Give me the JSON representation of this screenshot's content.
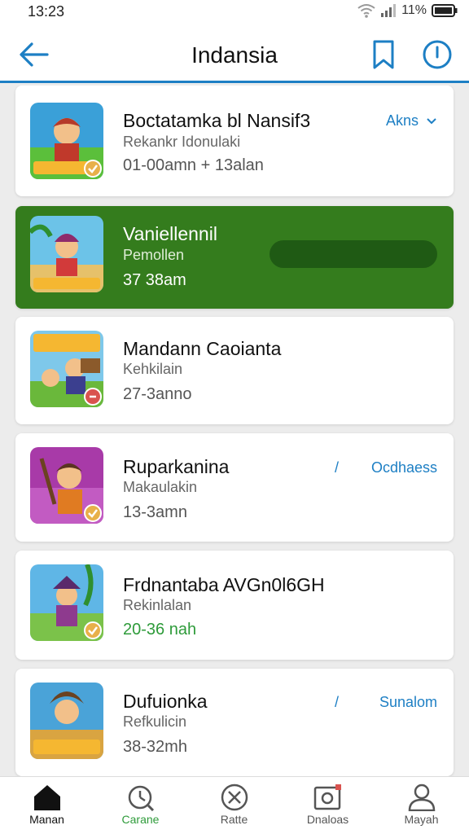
{
  "status_bar": {
    "time": "13:23",
    "battery": "11%"
  },
  "header": {
    "title": "Indansia"
  },
  "items": [
    {
      "title": "Boctatamka bl Nansif3",
      "subtitle": "Rekankr Idonulaki",
      "time": "01-00amn + 13alan",
      "action": "Akns",
      "badge": "check"
    },
    {
      "title": "Vaniellennil",
      "subtitle": "Pemollen",
      "time": "37 38am",
      "badge": "",
      "selected": true
    },
    {
      "title": "Mandann Caoianta",
      "subtitle": "Kehkilain",
      "time": "27-3anno",
      "badge": "x"
    },
    {
      "title": "Ruparkanina",
      "subtitle": "Makaulakin",
      "time": "13-3amn",
      "action": "Ocdhaess",
      "badge": "check"
    },
    {
      "title": "Frdnantaba AVGn0l6GH",
      "subtitle": "Rekinlalan",
      "time": "20-36 nah",
      "badge": "check"
    },
    {
      "title": "Dufuionka",
      "subtitle": "Refkulicin",
      "time": "38-32mh",
      "action": "Sunalom",
      "badge": ""
    }
  ],
  "bottom_nav": [
    {
      "label": "Manan",
      "icon": "home-icon"
    },
    {
      "label": "Carane",
      "icon": "clock-icon"
    },
    {
      "label": "Ratte",
      "icon": "close-circle-icon"
    },
    {
      "label": "Dnaloas",
      "icon": "photo-icon"
    },
    {
      "label": "Mayah",
      "icon": "profile-icon"
    }
  ],
  "colors": {
    "accent": "#1d7fc4",
    "active_row": "#347c1d",
    "active_pill": "#1f5a14",
    "green_text": "#2e9b3a"
  }
}
